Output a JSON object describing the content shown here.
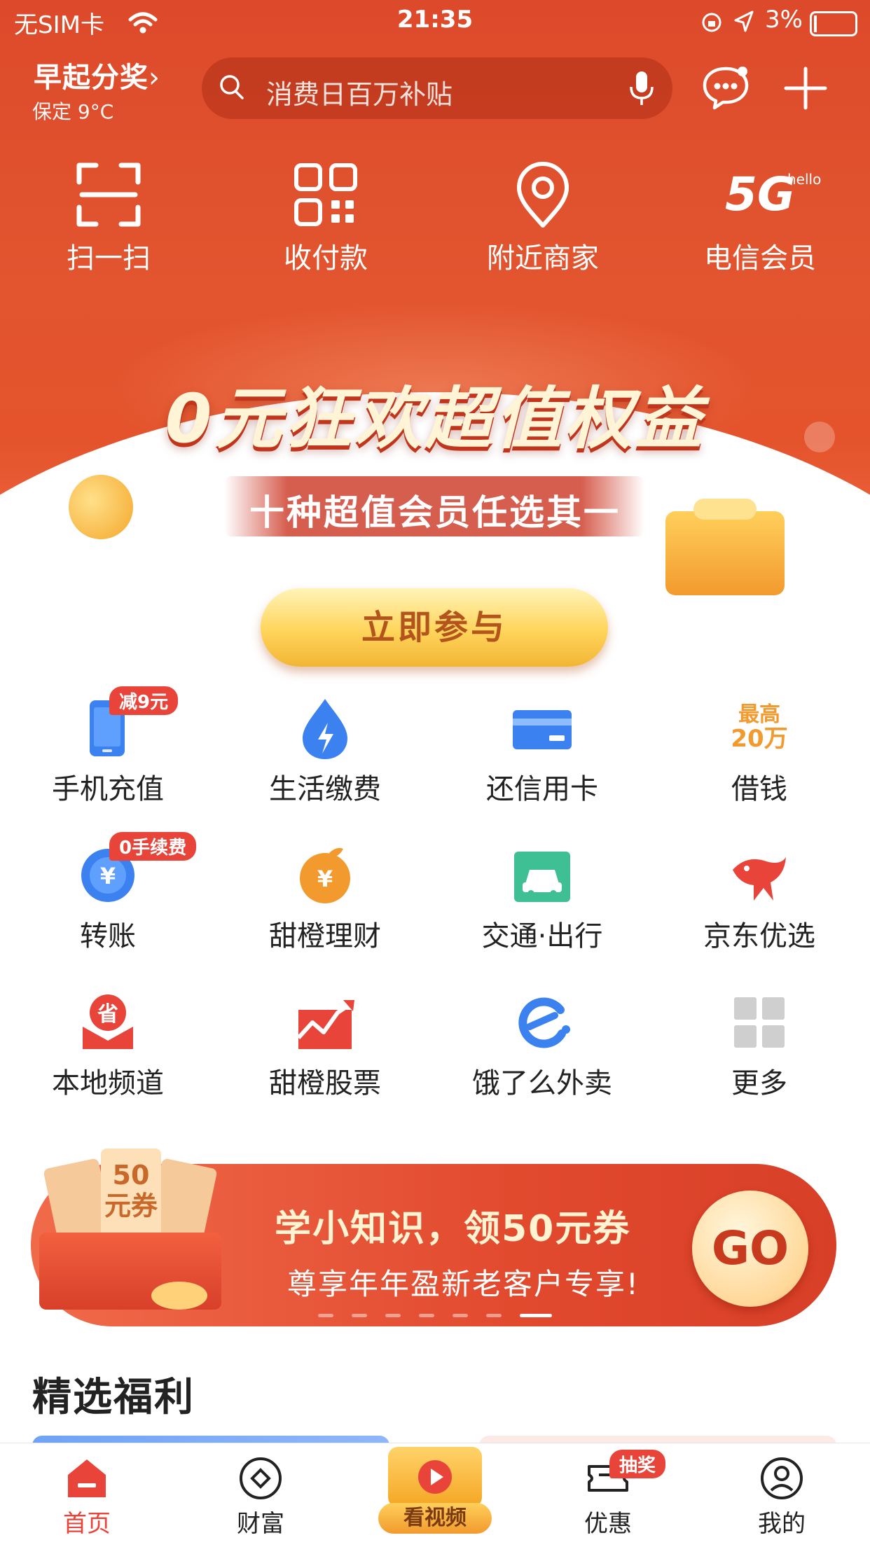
{
  "status_bar": {
    "carrier": "无SIM卡",
    "time": "21:35",
    "battery": "3%"
  },
  "header": {
    "weather_title": "早起分奖",
    "weather_sub": "保定 9°C",
    "search_placeholder": "消费日百万补贴"
  },
  "quick_actions": [
    {
      "label": "扫一扫",
      "icon": "scan-icon"
    },
    {
      "label": "收付款",
      "icon": "qrcode-icon"
    },
    {
      "label": "附近商家",
      "icon": "location-icon"
    },
    {
      "label": "电信会员",
      "icon": "5g-icon",
      "icon_text": "5G",
      "icon_sup": "hello"
    }
  ],
  "banner": {
    "title": "0元狂欢超值权益",
    "subtitle": "十种超值会员任选其一",
    "button": "立即参与"
  },
  "services": [
    {
      "label": "手机充值",
      "icon": "phone-icon",
      "badge": "减9元"
    },
    {
      "label": "生活缴费",
      "icon": "water-drop-icon"
    },
    {
      "label": "还信用卡",
      "icon": "credit-card-icon"
    },
    {
      "label": "借钱",
      "icon": "loan-icon",
      "icon_text_1": "最高",
      "icon_text_2": "20万"
    },
    {
      "label": "转账",
      "icon": "transfer-icon",
      "badge": "0手续费"
    },
    {
      "label": "甜橙理财",
      "icon": "orange-finance-icon"
    },
    {
      "label": "交通·出行",
      "icon": "car-icon"
    },
    {
      "label": "京东优选",
      "icon": "jd-dog-icon"
    },
    {
      "label": "本地频道",
      "icon": "local-icon",
      "icon_text": "省"
    },
    {
      "label": "甜橙股票",
      "icon": "stock-chart-icon"
    },
    {
      "label": "饿了么外卖",
      "icon": "eleme-icon"
    },
    {
      "label": "更多",
      "icon": "grid-more-icon"
    }
  ],
  "promo": {
    "title": "学小知识，领50元券",
    "subtitle": "尊享年年盈新老客户专享!",
    "button": "GO",
    "coupon_text": "50元券"
  },
  "section_title": "精选福利",
  "tabs": [
    {
      "label": "首页",
      "icon": "home-icon",
      "active": true
    },
    {
      "label": "财富",
      "icon": "wealth-icon"
    },
    {
      "label": "看视频",
      "icon": "video-tv-icon",
      "center": true
    },
    {
      "label": "优惠",
      "icon": "ticket-icon",
      "badge": "抽奖"
    },
    {
      "label": "我的",
      "icon": "profile-icon"
    }
  ],
  "colors": {
    "brand_red": "#e2552f",
    "accent_red": "#e8443a",
    "gold": "#ffd45a",
    "blue_icon": "#3b82f0"
  }
}
